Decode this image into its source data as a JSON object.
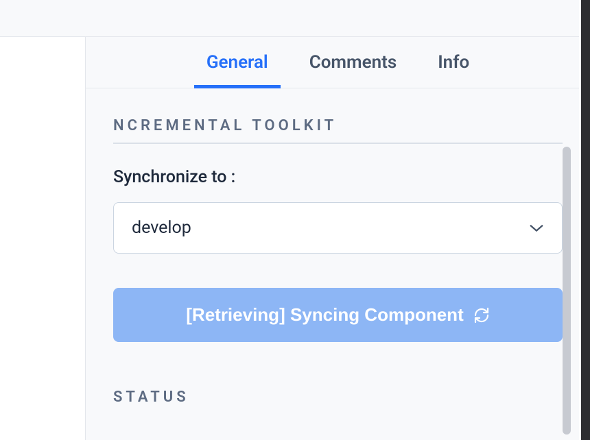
{
  "tabs": {
    "general": "General",
    "comments": "Comments",
    "info": "Info"
  },
  "toolkit": {
    "title": "NCREMENTAL TOOLKIT",
    "syncLabel": "Synchronize to :",
    "selectedBranch": "develop",
    "buttonText": "[Retrieving] Syncing Component"
  },
  "status": {
    "title": "STATUS"
  }
}
